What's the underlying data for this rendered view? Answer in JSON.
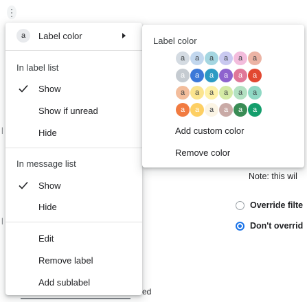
{
  "background": {
    "more_icon": "⋮",
    "note_text": "Note: this wil",
    "radio_options": [
      {
        "label": "Override filte",
        "selected": false
      },
      {
        "label": "Don't overrid",
        "selected": true
      }
    ],
    "partial_text": "ed"
  },
  "menu": {
    "label_color": {
      "badge": "a",
      "label": "Label color"
    },
    "in_label_list": {
      "header": "In label list",
      "items": [
        {
          "label": "Show",
          "checked": true
        },
        {
          "label": "Show if unread",
          "checked": false
        },
        {
          "label": "Hide",
          "checked": false
        }
      ]
    },
    "in_message_list": {
      "header": "In message list",
      "items": [
        {
          "label": "Show",
          "checked": true
        },
        {
          "label": "Hide",
          "checked": false
        }
      ]
    },
    "actions": [
      "Edit",
      "Remove label",
      "Add sublabel"
    ]
  },
  "submenu": {
    "title": "Label color",
    "swatch_glyph": "a",
    "swatches": [
      [
        "#d4dbe2",
        "#c2d7ee",
        "#a4d6e1",
        "#c9c9f0",
        "#f3bcdc",
        "#ecb4a5"
      ],
      [
        "#c5cbd1",
        "#3c78d8",
        "#2c9ac3",
        "#8e63ce",
        "#e07798",
        "#e24831"
      ],
      [
        "#f3bd9c",
        "#fbe48e",
        "#fef1a7",
        "#d4eaa5",
        "#b3e1c2",
        "#8fd8c4"
      ],
      [
        "#f17b41",
        "#fdcf63",
        "#fbf4e4",
        "#c9aaa6",
        "#3a8c55",
        "#149e6c"
      ]
    ],
    "swatch_text_colors": [
      [
        "#3c4043",
        "#3c4043",
        "#3c4043",
        "#3c4043",
        "#3c4043",
        "#3c4043"
      ],
      [
        "#ffffff",
        "#ffffff",
        "#ffffff",
        "#ffffff",
        "#ffffff",
        "#ffffff"
      ],
      [
        "#3c4043",
        "#3c4043",
        "#3c4043",
        "#3c4043",
        "#3c4043",
        "#3c4043"
      ],
      [
        "#ffffff",
        "#ffffff",
        "#3c4043",
        "#ffffff",
        "#ffffff",
        "#ffffff"
      ]
    ],
    "add_custom": "Add custom color",
    "remove": "Remove color"
  }
}
